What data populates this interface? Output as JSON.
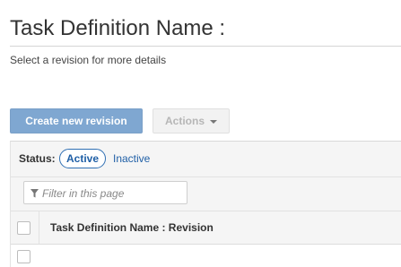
{
  "page": {
    "title": "Task Definition Name :",
    "subtitle": "Select a revision for more details"
  },
  "toolbar": {
    "create_label": "Create new revision",
    "actions_label": "Actions"
  },
  "status": {
    "label": "Status:",
    "active_label": "Active",
    "inactive_label": "Inactive",
    "selected": "Active"
  },
  "filter": {
    "placeholder": "Filter in this page",
    "value": ""
  },
  "table": {
    "columns": [
      "Task Definition Name : Revision"
    ],
    "rows": [
      {
        "revision": ""
      }
    ]
  },
  "colors": {
    "primary_button": "#7fa7d1",
    "link": "#1f5fa6",
    "panel_background": "#f5f5f5"
  },
  "icons": {
    "filter": "funnel-icon",
    "actions_dropdown": "caret-down-icon"
  }
}
